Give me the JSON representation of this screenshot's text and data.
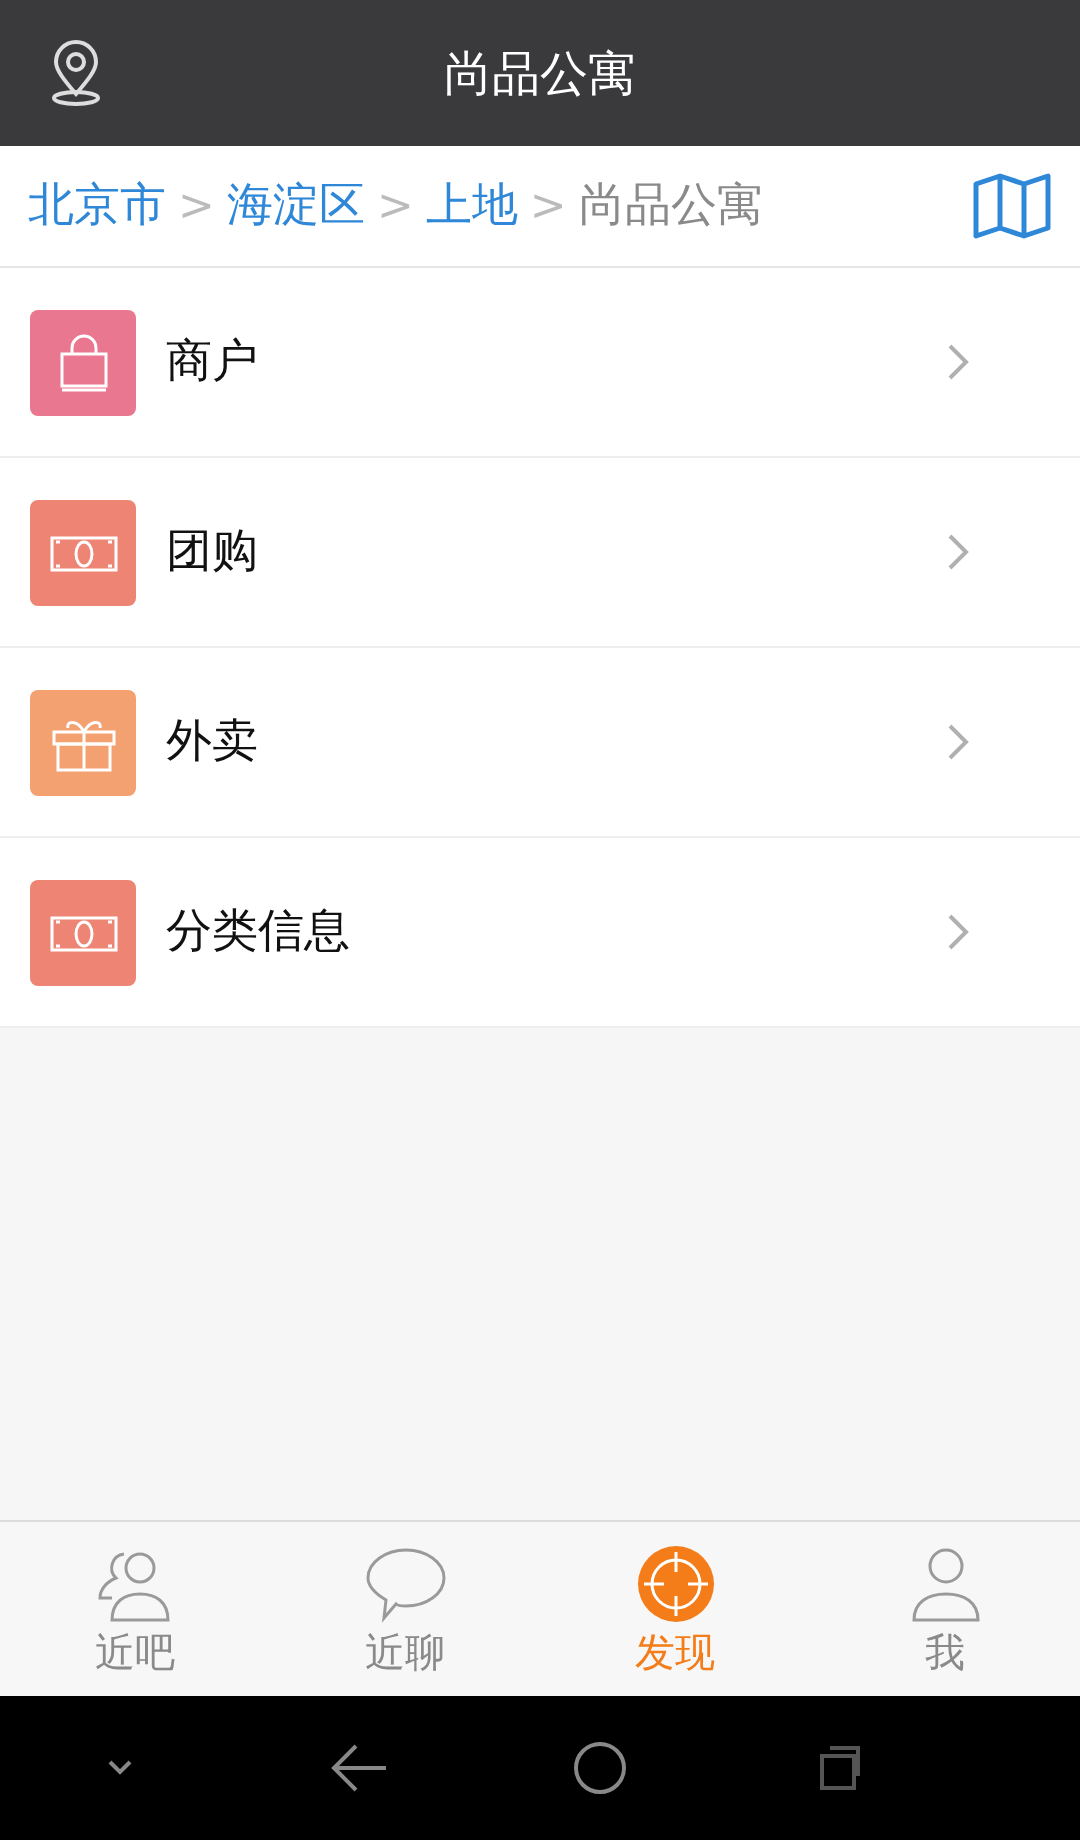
{
  "header": {
    "title": "尚品公寓"
  },
  "breadcrumb": [
    {
      "kind": "link",
      "label": "北京市"
    },
    {
      "kind": "separator",
      "label": ">"
    },
    {
      "kind": "link",
      "label": "海淀区"
    },
    {
      "kind": "separator",
      "label": ">"
    },
    {
      "kind": "link",
      "label": "上地"
    },
    {
      "kind": "separator",
      "label": ">"
    },
    {
      "kind": "current",
      "label": "尚品公寓"
    }
  ],
  "menu": [
    {
      "label": "商户",
      "kind": "bag",
      "color": "#e9778f"
    },
    {
      "label": "团购",
      "kind": "money",
      "color": "#ee8474"
    },
    {
      "label": "外卖",
      "kind": "gift",
      "color": "#f3a171"
    },
    {
      "label": "分类信息",
      "kind": "money",
      "color": "#ee8474"
    }
  ],
  "tabs": [
    {
      "label": "近吧",
      "kind": "people",
      "selected": false
    },
    {
      "label": "近聊",
      "kind": "chat",
      "selected": false
    },
    {
      "label": "发现",
      "kind": "target",
      "selected": true
    },
    {
      "label": "我",
      "kind": "person",
      "selected": false
    }
  ]
}
